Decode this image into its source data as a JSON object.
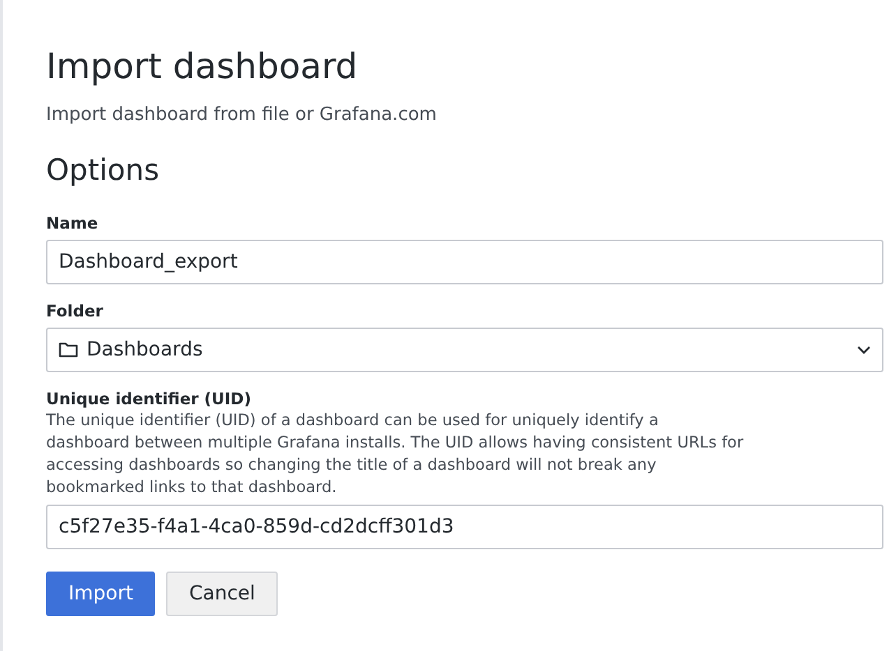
{
  "title": "Import dashboard",
  "subtitle": "Import dashboard from file or Grafana.com",
  "section": "Options",
  "fields": [
    {
      "kind": "text",
      "label": "Name",
      "value": "Dashboard_export"
    },
    {
      "kind": "folder-select",
      "label": "Folder",
      "value": "Dashboards"
    },
    {
      "kind": "text",
      "label": "Unique identifier (UID)",
      "description": "The unique identifier (UID) of a dashboard can be used for uniquely identify a dashboard between multiple Grafana installs. The UID allows having consistent URLs for accessing dashboards so changing the title of a dashboard will not break any bookmarked links to that dashboard.",
      "value": "c5f27e35-f4a1-4ca0-859d-cd2dcff301d3"
    }
  ],
  "buttons": [
    {
      "label": "Import",
      "kind": "primary"
    },
    {
      "label": "Cancel",
      "kind": "secondary"
    }
  ]
}
